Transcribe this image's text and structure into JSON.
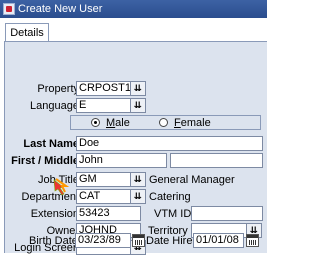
{
  "window": {
    "title": "Create New User"
  },
  "tabs": [
    {
      "label": "Details"
    }
  ],
  "form": {
    "property": {
      "label": "Property",
      "value": "CRPOST1"
    },
    "language": {
      "label": "Language",
      "value": "E"
    },
    "gender": {
      "options": [
        "Male",
        "Female"
      ],
      "selected": "Male"
    },
    "last_name": {
      "label": "Last Name",
      "value": "Doe"
    },
    "first_middle": {
      "label": "First / Middle",
      "first": "John",
      "middle": ""
    },
    "job_title": {
      "label": "Job Title",
      "value": "GM",
      "description": "General Manager"
    },
    "department": {
      "label": "Department",
      "value": "CAT",
      "description": "Catering"
    },
    "extension": {
      "label": "Extension",
      "value": "53423"
    },
    "vtm_id": {
      "label": "VTM ID",
      "value": ""
    },
    "owner": {
      "label": "Owner",
      "value": "JOHND"
    },
    "territory": {
      "label": "Territory",
      "value": ""
    },
    "login_screen": {
      "label": "Login Screen",
      "value": ""
    },
    "birth_date": {
      "label": "Birth Date",
      "value": "03/23/89"
    },
    "date_hired": {
      "label": "Date Hired",
      "value": "01/01/08"
    }
  },
  "icons": {
    "lov": "down-arrow-list-icon",
    "calendar": "calendar-icon",
    "cursor": "pointer-hand-icon"
  },
  "colors": {
    "titlebar": "#2b4d8e",
    "panel": "#dce3ee"
  }
}
